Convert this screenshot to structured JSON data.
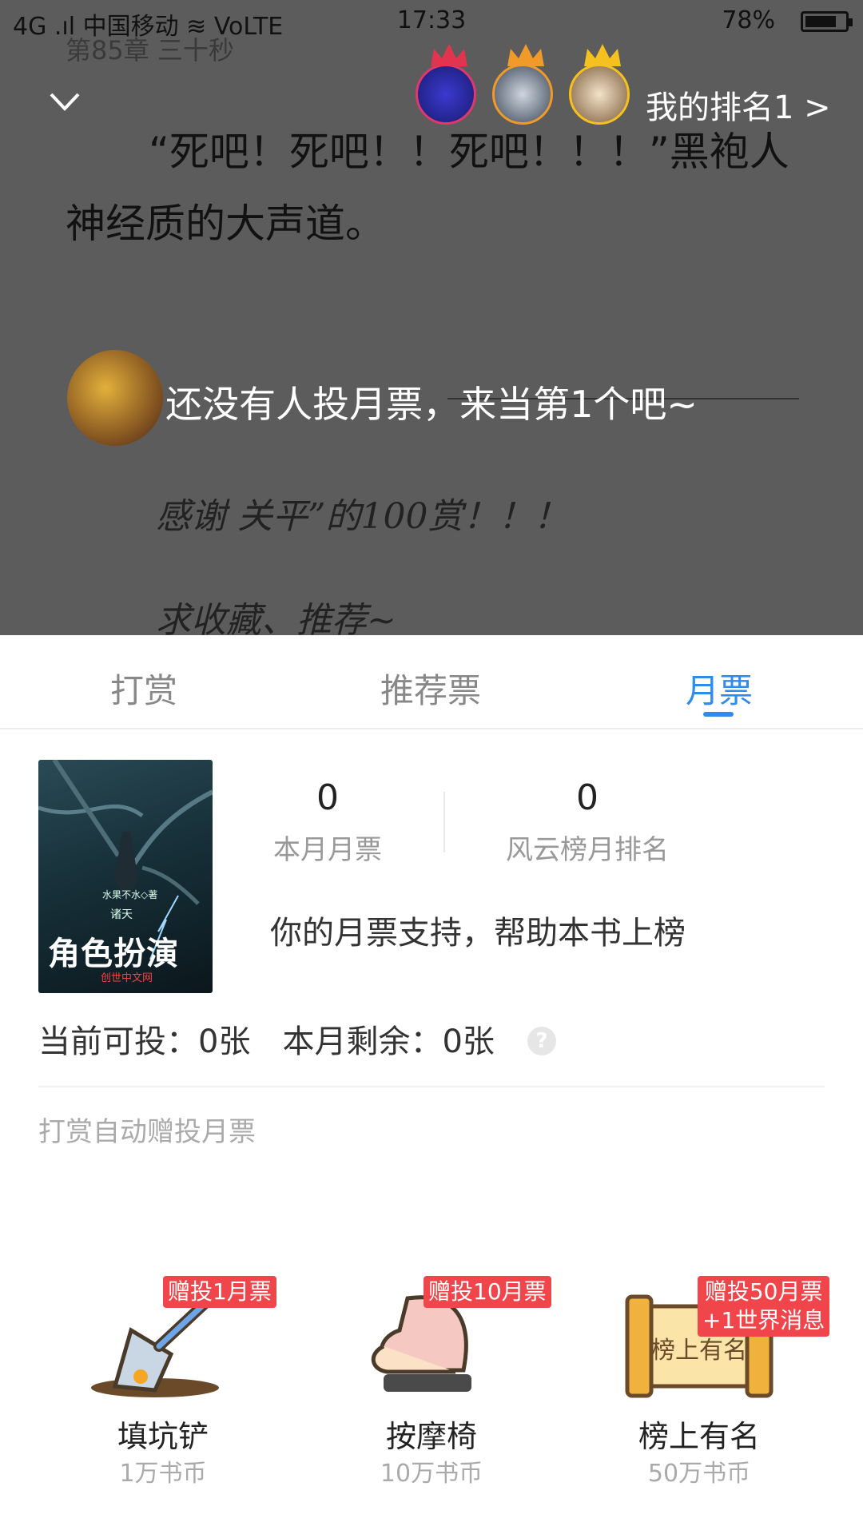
{
  "status_bar": {
    "carrier": "4G .ıl 中国移动 ≋ VoLTE",
    "time": "17:33",
    "battery": "78%"
  },
  "reader": {
    "chapter_title": "第85章 三十秒",
    "my_rank": "我的排名1 >",
    "paragraph_line1": "“死吧！死吧！！死吧！！！”黑袍人",
    "paragraph_line2": "神经质的大声道。",
    "toast": "还没有人投月票，来当第1个吧~",
    "note_line1": "感谢 关平”的100赏！！！",
    "note_line2": "求收藏、推荐~"
  },
  "tabs": [
    {
      "label": "打赏"
    },
    {
      "label": "推荐票"
    },
    {
      "label": "月票"
    }
  ],
  "book": {
    "cover_author": "水果不水◇著",
    "cover_series": "诸天",
    "cover_title": "角色扮演",
    "cover_publisher": "创世中文网"
  },
  "stats": {
    "monthly_votes": "0",
    "monthly_votes_label": "本月月票",
    "rank": "0",
    "rank_label": "风云榜月排名"
  },
  "support_text": "你的月票支持，帮助本书上榜",
  "quota": {
    "current": "当前可投：0张",
    "remaining": "本月剩余：0张",
    "help": "?"
  },
  "auto_note": "打赏自动赠投月票",
  "gifts": [
    {
      "name": "填坑铲",
      "price": "1万书币",
      "badge": "赠投1月票",
      "badge2": ""
    },
    {
      "name": "按摩椅",
      "price": "10万书币",
      "badge": "赠投10月票",
      "badge2": ""
    },
    {
      "name": "榜上有名",
      "price": "50万书币",
      "badge": "赠投50月票",
      "badge2": "+1世界消息"
    }
  ],
  "scroll_text": "榜上有名",
  "colors": {
    "accent": "#2f8cec",
    "badge": "#f0454a",
    "overlay": "#5c5c5c"
  }
}
